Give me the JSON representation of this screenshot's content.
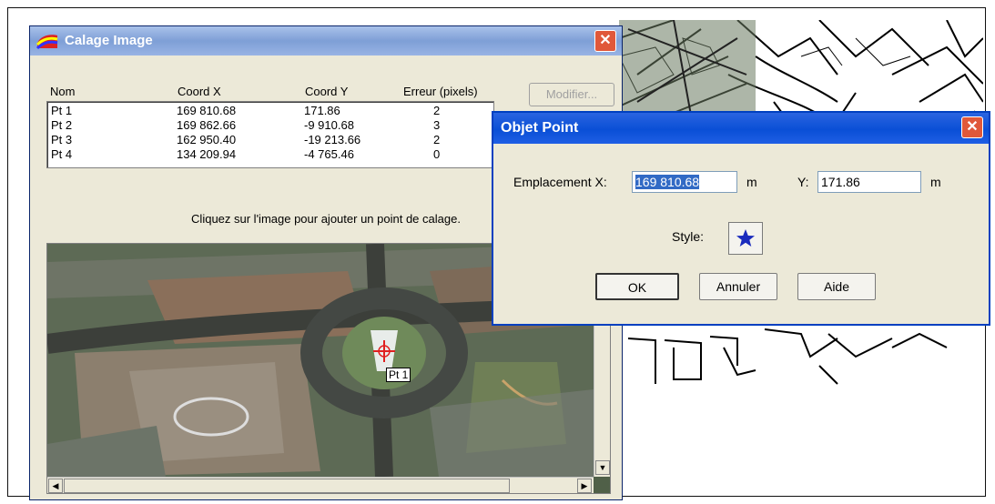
{
  "calage_window": {
    "title": "Calage Image",
    "columns": [
      "Nom",
      "Coord X",
      "Coord Y",
      "Erreur (pixels)"
    ],
    "points": [
      {
        "nom": "Pt 1",
        "x": "169 810.68",
        "y": "171.86",
        "err": "2"
      },
      {
        "nom": "Pt 2",
        "x": "169 862.66",
        "y": "-9 910.68",
        "err": "3"
      },
      {
        "nom": "Pt 3",
        "x": "162 950.40",
        "y": "-19 213.66",
        "err": "2"
      },
      {
        "nom": "Pt 4",
        "x": "134 209.94",
        "y": "-4 765.46",
        "err": "0"
      }
    ],
    "modify_label": "Modifier...",
    "instruction": "Cliquez sur l'image pour ajouter un point de calage.",
    "marker_label": "Pt 1"
  },
  "objet_point": {
    "title": "Objet Point",
    "x_label": "Emplacement X:",
    "x_value": "169 810.68",
    "x_unit": "m",
    "y_label": "Y:",
    "y_value": "171.86",
    "y_unit": "m",
    "style_label": "Style:",
    "style_icon": "blue-star-icon",
    "ok_label": "OK",
    "cancel_label": "Annuler",
    "help_label": "Aide"
  }
}
